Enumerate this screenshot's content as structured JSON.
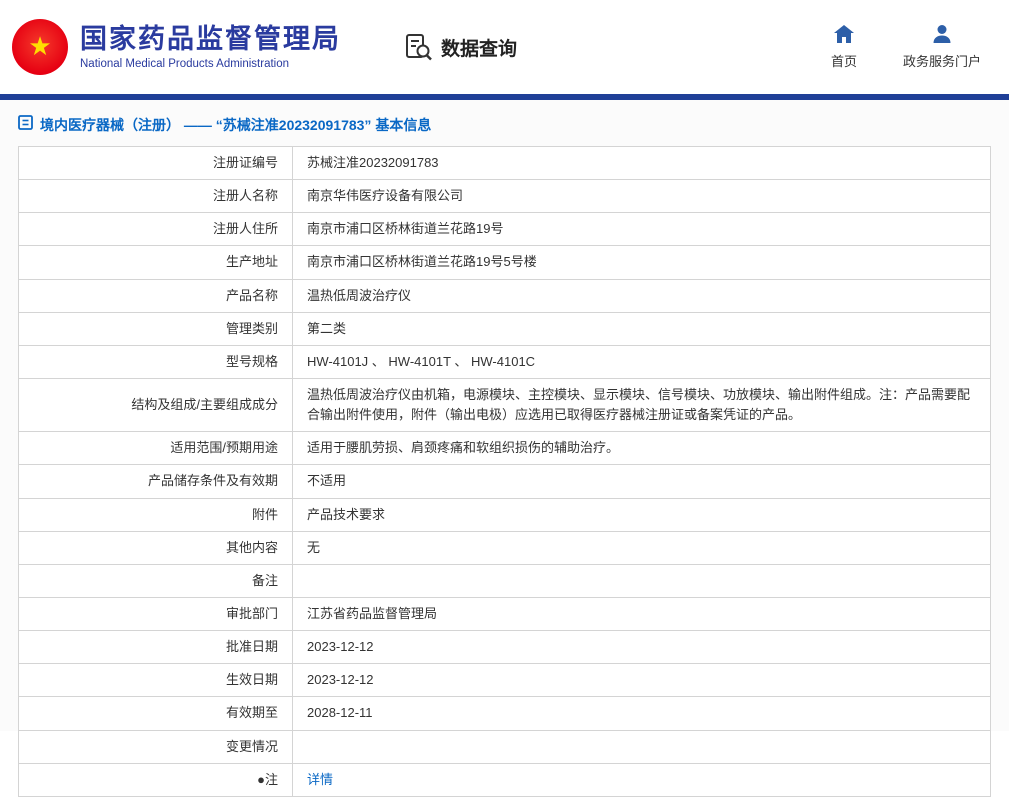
{
  "header": {
    "org_name_cn": "国家药品监督管理局",
    "org_name_en": "National Medical Products Administration",
    "data_query_label": "数据查询",
    "nav_home_label": "首页",
    "nav_portal_label": "政务服务门户"
  },
  "breadcrumb": {
    "title": "境内医疗器械（注册） —— “苏械注准20232091783” 基本信息"
  },
  "colors": {
    "brand_blue": "#2a3b9f",
    "bar_blue": "#1f3f97",
    "link_blue": "#0a68c5",
    "icon_blue": "#2d5fa8",
    "emblem_red": "#e60012"
  },
  "table": {
    "rows": [
      {
        "label": "注册证编号",
        "value": "苏械注准20232091783"
      },
      {
        "label": "注册人名称",
        "value": "南京华伟医疗设备有限公司"
      },
      {
        "label": "注册人住所",
        "value": "南京市浦口区桥林街道兰花路19号"
      },
      {
        "label": "生产地址",
        "value": "南京市浦口区桥林街道兰花路19号5号楼"
      },
      {
        "label": "产品名称",
        "value": "温热低周波治疗仪"
      },
      {
        "label": "管理类别",
        "value": "第二类"
      },
      {
        "label": "型号规格",
        "value": "HW-4101J 、 HW-4101T 、 HW-4101C"
      },
      {
        "label": "结构及组成/主要组成成分",
        "value": "温热低周波治疗仪由机箱，电源模块、主控模块、显示模块、信号模块、功放模块、输出附件组成。注：产品需要配合输出附件使用，附件（输出电极）应选用已取得医疗器械注册证或备案凭证的产品。"
      },
      {
        "label": "适用范围/预期用途",
        "value": "适用于腰肌劳损、肩颈疼痛和软组织损伤的辅助治疗。"
      },
      {
        "label": "产品储存条件及有效期",
        "value": "不适用"
      },
      {
        "label": "附件",
        "value": "产品技术要求"
      },
      {
        "label": "其他内容",
        "value": "无"
      },
      {
        "label": "备注",
        "value": ""
      },
      {
        "label": "审批部门",
        "value": "江苏省药品监督管理局"
      },
      {
        "label": "批准日期",
        "value": "2023-12-12"
      },
      {
        "label": "生效日期",
        "value": "2023-12-12"
      },
      {
        "label": "有效期至",
        "value": "2028-12-11"
      },
      {
        "label": "变更情况",
        "value": ""
      },
      {
        "label": "●注",
        "value": "详情",
        "link": true
      }
    ]
  }
}
